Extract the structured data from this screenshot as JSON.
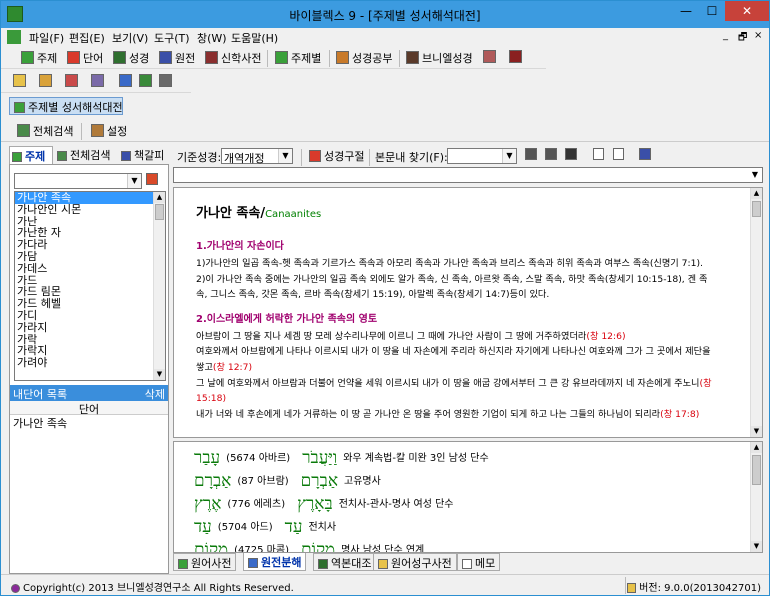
{
  "window": {
    "title": "바이블렉스 9 - [주제별 성서해석대전]",
    "minimize": "—",
    "maximize": "☐",
    "close": "✕"
  },
  "menu": {
    "items": [
      "파일(F)",
      "편집(E)",
      "보기(V)",
      "도구(T)",
      "창(W)",
      "도움말(H)"
    ],
    "mdi_controls": [
      "_",
      "🗗",
      "×"
    ]
  },
  "toolbar1": {
    "items": [
      "주제",
      "단어",
      "성경",
      "원전",
      "신학사전",
      "주제별",
      "성경공부",
      "브니엘성경"
    ]
  },
  "mdi_tab": {
    "label": "주제별 성서해석대전"
  },
  "subtoolbar": {
    "search_all": "전체검색",
    "settings": "설정"
  },
  "left_tabs": {
    "items": [
      "주제",
      "전체검색",
      "책갈피"
    ]
  },
  "topic_list": {
    "items": [
      "가나안 족속",
      "가나안인 시몬",
      "가난",
      "가난한 자",
      "가다라",
      "가담",
      "가데스",
      "가드",
      "가드 림몬",
      "가드 헤벨",
      "가디",
      "가라지",
      "가락",
      "가락지",
      "가려야"
    ],
    "selected_index": 0
  },
  "my_words": {
    "title": "내단어 목록",
    "delete": "삭제",
    "column": "단어",
    "items": [
      "가나안 족속"
    ]
  },
  "right_toolbar": {
    "base_bible_label": "기준성경:",
    "base_bible_value": "개역개정",
    "verse_label": "성경구절",
    "find_label": "본문내 찾기(F):"
  },
  "article": {
    "title": "가나안 족속/",
    "title_en": "Canaanites",
    "section1_title": "1.가나안의 자손이다",
    "section1_p1": "1)가나안의 일곱 족속-헷 족속과 기르가스 족속과 아모리 족속과 가나안 족속과 브리스 족속과 히위 족속과 여부스 족속(신명기 7:1).",
    "section1_p2": "2)이 가나안 족속 중에는 가나안의 일곱 족속 외에도 알가 족속, 신 족속, 아르왓 족속, 스말 족속, 하맛 족속(창세기 10:15-18), 겐 족속, 그니스 족속, 갓몬 족속, 르바 족속(창세기 15:19), 아말렉 족속(창세기 14:7)등이 있다.",
    "section2_title": "2.이스라엘에게 허락한 가나안 족속의 영토",
    "section2_p1": "아브람이 그 땅을 지나 세겜 땅 모레 상수리나무에 이르니 그 때에 가나안 사람이 그 땅에 거주하였더라",
    "ref1": "(창 12:6)",
    "section2_p2": "여호와께서 아브람에게 나타나 이르시되 내가 이 땅을 네 자손에게 주리라 하신지라 자기에게 나타나신 여호와께 그가 그 곳에서 제단을 쌓고",
    "ref2": "(창 12:7)",
    "section2_p3": "그 날에 여호와께서 아브람과 더불어 언약을 세워 이르시되 내가 이 땅을 애굽 강에서부터 그 큰 강 유브라데까지 네 자손에게 주노니",
    "ref3": "(창 15:18)",
    "section2_p4": "내가 너와 네 후손에게 네가 거류하는 이 땅 곧 가나안 온 땅을 주어 영원한 기업이 되게 하고 나는 그들의 하나님이 되리라",
    "ref4": "(창 17:8)"
  },
  "hebrew_rows": [
    {
      "word": "עָבַר",
      "num": "(5674 아바르)",
      "inflected": "וַיַּעֲבֹר",
      "desc": "와우 계속법-칼 미완 3인 남성 단수"
    },
    {
      "word": "אַבְרָם",
      "num": "(87 아브람)",
      "inflected": "אַבְרָם",
      "desc": "고유명사"
    },
    {
      "word": "אֶרֶץ",
      "num": "(776 에레츠)",
      "inflected": "בָּאָרֶץ",
      "desc": "전치사-관사-명사 여성 단수"
    },
    {
      "word": "עַד",
      "num": "(5704 아드)",
      "inflected": "עַד",
      "desc": "전치사"
    },
    {
      "word": "מָקוֹם",
      "num": "(4725 마콤)",
      "inflected": "מְקוֹם",
      "desc": "명사 남성 단수 연계"
    }
  ],
  "bottom_tabs": {
    "items": [
      "원어사전",
      "원전분해",
      "역본대조",
      "원어성구사전",
      "메모"
    ],
    "active_index": 1
  },
  "status": {
    "copyright": "Copyright(c) 2013 브니엘성경연구소 All Rights Reserved.",
    "version": "버전: 9.0.0(2013042701)"
  }
}
